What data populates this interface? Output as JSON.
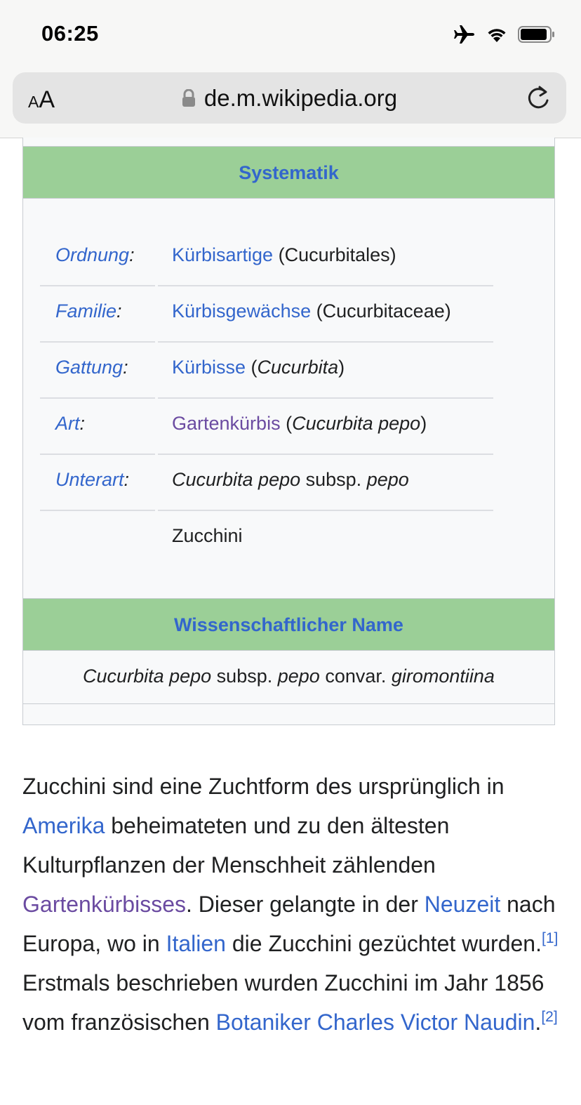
{
  "status_bar": {
    "time": "06:25"
  },
  "browser": {
    "aa_small": "A",
    "aa_large": "A",
    "url": "de.m.wikipedia.org"
  },
  "infobox": {
    "systematik_header": "Systematik",
    "rows": [
      {
        "label": "Ordnung",
        "link": "Kürbisartige",
        "rest": " (Cucurbitales)"
      },
      {
        "label": "Familie",
        "link": "Kürbisgewächse",
        "rest": " (Cucurbitaceae)"
      },
      {
        "label": "Gattung",
        "link": "Kürbisse",
        "rest_open": " (",
        "rest_it": "Cucurbita",
        "rest_close": ")"
      },
      {
        "label": "Art",
        "link": "Gartenkürbis",
        "rest_open": " (",
        "rest_it": "Cucurbita pepo",
        "rest_close": ")"
      },
      {
        "label": "Unterart",
        "it1": "Cucurbita pepo",
        "mid": " subsp. ",
        "it2": "pepo"
      },
      {
        "value": "Zucchini"
      }
    ],
    "colon": ":",
    "name_header": "Wissenschaftlicher Name",
    "scientific_name": {
      "it1": "Cucurbita pepo",
      "t1": " subsp. ",
      "it2": "pepo",
      "t2": " convar. ",
      "it3": "giromontiina"
    }
  },
  "article": {
    "t1": "Zucchini sind eine Zuchtform des ursprünglich in ",
    "link_amerika": "Amerika",
    "t2": " beheimateten und zu den ältesten Kulturpflanzen der Menschheit zählenden ",
    "link_gartenkuerbis": "Gartenkürbisses",
    "t3": ". Dieser gelangte in der ",
    "link_neuzeit": "Neuzeit",
    "t4": " nach Europa, wo in ",
    "link_italien": "Italien",
    "t5": " die Zucchini gezüchtet wurden.",
    "ref1": "[1]",
    "t6": " Erstmals beschrieben wurden Zucchini im Jahr 1856 vom französischen ",
    "link_botaniker": "Botaniker",
    "link_naudin": "Charles Victor Naudin",
    "t7": ".",
    "ref2": "[2]"
  }
}
